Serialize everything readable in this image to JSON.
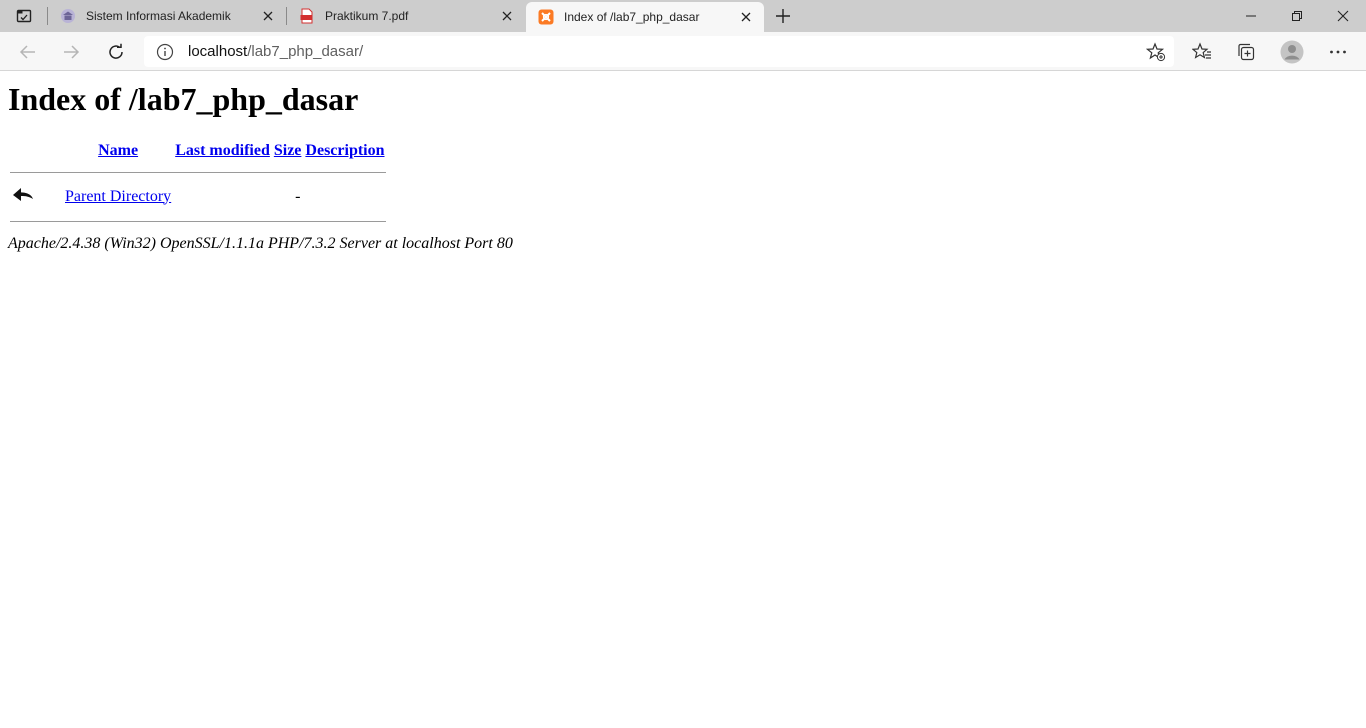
{
  "browser": {
    "tabs": [
      {
        "title": "Sistem Informasi Akademik",
        "active": false
      },
      {
        "title": "Praktikum 7.pdf",
        "active": false
      },
      {
        "title": "Index of /lab7_php_dasar",
        "active": true
      }
    ],
    "address": {
      "host": "localhost",
      "path": "/lab7_php_dasar/"
    }
  },
  "page": {
    "heading": "Index of /lab7_php_dasar",
    "columns": {
      "name": "Name",
      "modified": "Last modified",
      "size": "Size",
      "description": "Description"
    },
    "rows": [
      {
        "name": "Parent Directory",
        "modified": "",
        "size": "-",
        "description": ""
      }
    ],
    "footer": "Apache/2.4.38 (Win32) OpenSSL/1.1.1a PHP/7.3.2 Server at localhost Port 80"
  },
  "colors": {
    "link": "#0000ee",
    "tabstrip": "#cdcdcd",
    "toolbar": "#f7f7f7",
    "xampp_orange": "#fb7a24",
    "pdf_red": "#d32f2f"
  }
}
